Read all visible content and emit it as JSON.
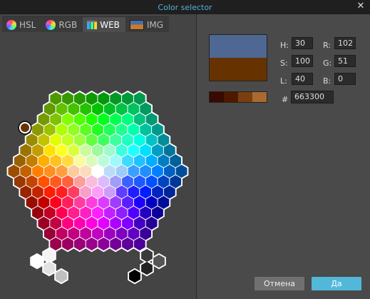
{
  "window": {
    "title": "Color selector",
    "close": "✕"
  },
  "tabs": [
    {
      "label": "HSL",
      "icon": "color-wheel-icon",
      "active": false
    },
    {
      "label": "RGB",
      "icon": "rgb-wheel-icon",
      "active": false
    },
    {
      "label": "WEB",
      "icon": "web-grid-icon",
      "active": true
    },
    {
      "label": "IMG",
      "icon": "image-icon",
      "active": false
    }
  ],
  "fields": {
    "h_label": "H:",
    "h_value": "30",
    "s_label": "S:",
    "s_value": "100",
    "l_label": "L:",
    "l_value": "40",
    "r_label": "R:",
    "r_value": "102",
    "g_label": "G:",
    "g_value": "51",
    "b_label": "B:",
    "b_value": "0"
  },
  "hex": {
    "label": "#",
    "value": "663300"
  },
  "preview": {
    "new_color": "#4f6893",
    "old_color": "#663300"
  },
  "swatches": [
    "#3a0a00",
    "#4d1a00",
    "#7a3f10",
    "#a86a30"
  ],
  "buttons": {
    "cancel": "Отмена",
    "ok": "Да"
  }
}
